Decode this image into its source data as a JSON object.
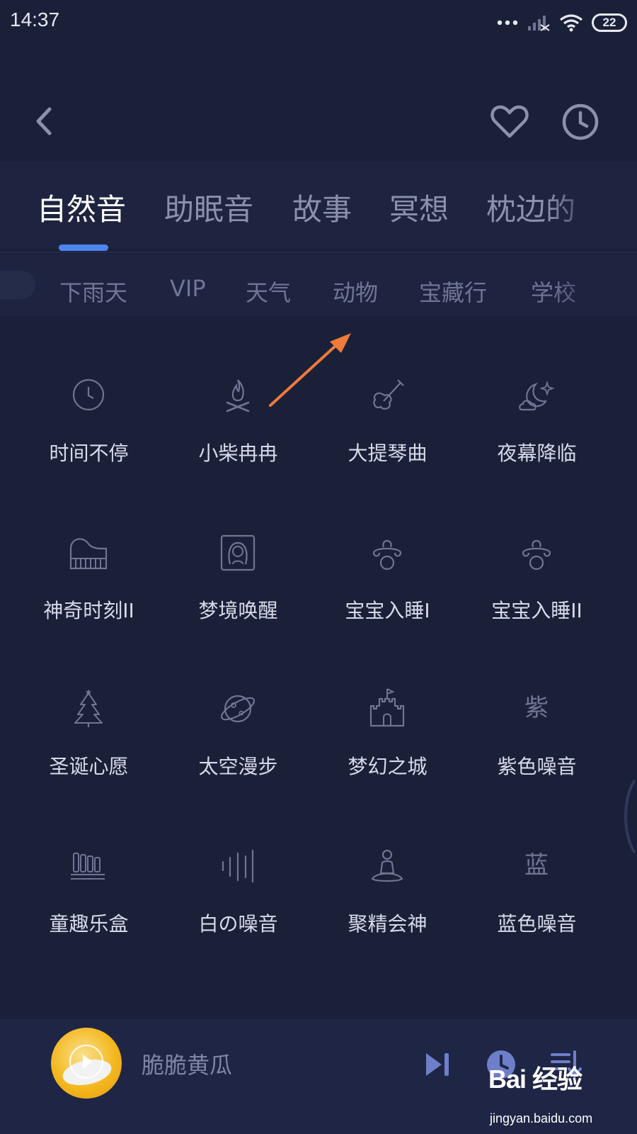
{
  "status_bar": {
    "time": "14:37",
    "battery": "22"
  },
  "header": {
    "back_icon": "chevron-left-icon",
    "favorite_icon": "heart-icon",
    "history_icon": "clock-icon"
  },
  "main_tabs": [
    {
      "label": "自然音",
      "active": true
    },
    {
      "label": "助眠音",
      "active": false
    },
    {
      "label": "故事",
      "active": false
    },
    {
      "label": "冥想",
      "active": false
    },
    {
      "label": "枕边的",
      "active": false
    }
  ],
  "sub_tabs": [
    {
      "label": "下雨天"
    },
    {
      "label": "VIP"
    },
    {
      "label": "天气"
    },
    {
      "label": "动物"
    },
    {
      "label": "宝藏行"
    },
    {
      "label": "学校"
    }
  ],
  "sounds": [
    {
      "label": "时间不停",
      "icon": "clock-icon"
    },
    {
      "label": "小柴冉冉",
      "icon": "campfire-icon"
    },
    {
      "label": "大提琴曲",
      "icon": "violin-icon"
    },
    {
      "label": "夜幕降临",
      "icon": "moon-cloud-icon"
    },
    {
      "label": "神奇时刻II",
      "icon": "piano-icon"
    },
    {
      "label": "梦境唤醒",
      "icon": "girl-portrait-icon"
    },
    {
      "label": "宝宝入睡I",
      "icon": "pacifier-icon"
    },
    {
      "label": "宝宝入睡II",
      "icon": "pacifier-icon"
    },
    {
      "label": "圣诞心愿",
      "icon": "christmas-tree-icon"
    },
    {
      "label": "太空漫步",
      "icon": "planet-icon"
    },
    {
      "label": "梦幻之城",
      "icon": "castle-icon"
    },
    {
      "label": "紫色噪音",
      "icon_text": "紫"
    },
    {
      "label": "童趣乐盒",
      "icon": "xylophone-icon"
    },
    {
      "label": "白の噪音",
      "icon": "sound-wave-icon"
    },
    {
      "label": "聚精会神",
      "icon": "meditation-icon"
    },
    {
      "label": "蓝色噪音",
      "icon_text": "蓝"
    }
  ],
  "player": {
    "title": "脆脆黄瓜",
    "next_icon": "skip-next-icon",
    "timer_icon": "timer-icon",
    "playlist_icon": "playlist-icon"
  },
  "watermark": {
    "logo": "Bai 经验",
    "url": "jingyan.baidu.com"
  },
  "colors": {
    "background": "#1b2039",
    "accent": "#4d86f0",
    "annotation_arrow": "#f07a3a"
  }
}
